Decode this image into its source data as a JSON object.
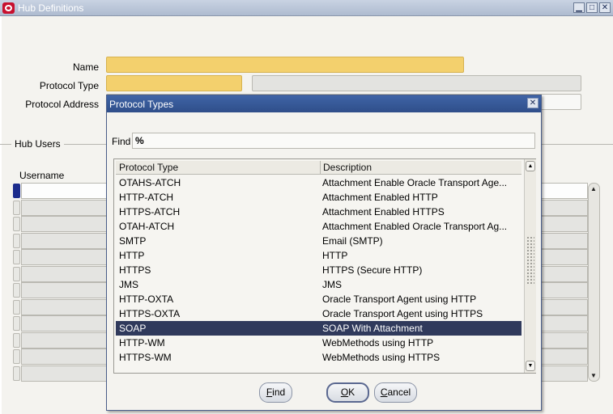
{
  "window": {
    "title": "Hub Definitions"
  },
  "form": {
    "name_label": "Name",
    "protocol_type_label": "Protocol Type",
    "protocol_address_label": "Protocol Address",
    "hub_users_label": "Hub Users",
    "username_header": "Username"
  },
  "dialog": {
    "title": "Protocol Types",
    "find_label": "Find",
    "find_value": "%",
    "col_type": "Protocol Type",
    "col_desc": "Description",
    "rows": [
      {
        "type": "OTAHS-ATCH",
        "desc": "Attachment Enable Oracle Transport Age..."
      },
      {
        "type": "HTTP-ATCH",
        "desc": "Attachment Enabled HTTP"
      },
      {
        "type": "HTTPS-ATCH",
        "desc": "Attachment Enabled HTTPS"
      },
      {
        "type": "OTAH-ATCH",
        "desc": "Attachment Enabled Oracle Transport Ag..."
      },
      {
        "type": "SMTP",
        "desc": "Email (SMTP)"
      },
      {
        "type": "HTTP",
        "desc": "HTTP"
      },
      {
        "type": "HTTPS",
        "desc": "HTTPS (Secure HTTP)"
      },
      {
        "type": "JMS",
        "desc": "JMS"
      },
      {
        "type": "HTTP-OXTA",
        "desc": "Oracle Transport Agent using HTTP"
      },
      {
        "type": "HTTPS-OXTA",
        "desc": "Oracle Transport Agent using HTTPS"
      },
      {
        "type": "SOAP",
        "desc": "SOAP With Attachment"
      },
      {
        "type": "HTTP-WM",
        "desc": "WebMethods using HTTP"
      },
      {
        "type": "HTTPS-WM",
        "desc": "WebMethods using HTTPS"
      }
    ],
    "find_button": {
      "mnemonic": "F",
      "rest": "ind"
    },
    "ok_button": {
      "mnemonic": "O",
      "rest": "K"
    },
    "cancel_button": {
      "mnemonic": "C",
      "rest": "ancel"
    }
  },
  "icons": {
    "app": "oracle-logo-icon",
    "minimize": "minimize-icon",
    "maximize": "maximize-icon",
    "close": "close-icon"
  },
  "colors": {
    "required_field": "#f3d06d",
    "selected_row": "#303a5c",
    "dialog_title": "#3f64a6"
  }
}
